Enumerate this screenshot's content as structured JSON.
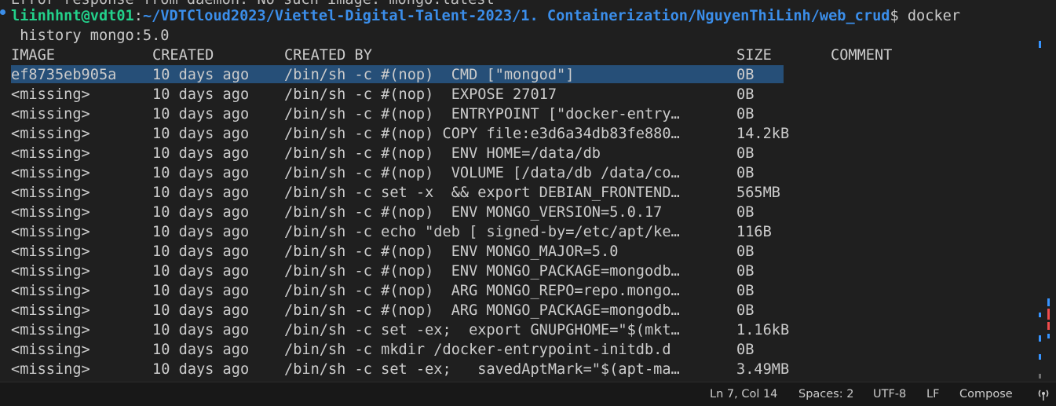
{
  "terminal": {
    "clipped_line": "Error response from daemon: No such image: mongo:latest",
    "prompt": {
      "user_host": "liinhhnt@vdt01",
      "colon": ":",
      "path": "~/VDTCloud2023/Viettel-Digital-Talent-2023/1. Containerization/NguyenThiLinh/web_crud",
      "dollar": "$ docker"
    },
    "command_continuation": " history mongo:5.0",
    "table": {
      "headers": {
        "image": "IMAGE",
        "created": "CREATED",
        "created_by": "CREATED BY",
        "size": "SIZE",
        "comment": "COMMENT"
      },
      "rows": [
        {
          "image": "ef8735eb905a",
          "created": "10 days ago",
          "created_by": "/bin/sh -c #(nop)  CMD [\"mongod\"]",
          "size": "0B"
        },
        {
          "image": "<missing>",
          "created": "10 days ago",
          "created_by": "/bin/sh -c #(nop)  EXPOSE 27017",
          "size": "0B"
        },
        {
          "image": "<missing>",
          "created": "10 days ago",
          "created_by": "/bin/sh -c #(nop)  ENTRYPOINT [\"docker-entry…",
          "size": "0B"
        },
        {
          "image": "<missing>",
          "created": "10 days ago",
          "created_by": "/bin/sh -c #(nop) COPY file:e3d6a34db83fe880…",
          "size": "14.2kB"
        },
        {
          "image": "<missing>",
          "created": "10 days ago",
          "created_by": "/bin/sh -c #(nop)  ENV HOME=/data/db",
          "size": "0B"
        },
        {
          "image": "<missing>",
          "created": "10 days ago",
          "created_by": "/bin/sh -c #(nop)  VOLUME [/data/db /data/co…",
          "size": "0B"
        },
        {
          "image": "<missing>",
          "created": "10 days ago",
          "created_by": "/bin/sh -c set -x  && export DEBIAN_FRONTEND…",
          "size": "565MB"
        },
        {
          "image": "<missing>",
          "created": "10 days ago",
          "created_by": "/bin/sh -c #(nop)  ENV MONGO_VERSION=5.0.17",
          "size": "0B"
        },
        {
          "image": "<missing>",
          "created": "10 days ago",
          "created_by": "/bin/sh -c echo \"deb [ signed-by=/etc/apt/ke…",
          "size": "116B"
        },
        {
          "image": "<missing>",
          "created": "10 days ago",
          "created_by": "/bin/sh -c #(nop)  ENV MONGO_MAJOR=5.0",
          "size": "0B"
        },
        {
          "image": "<missing>",
          "created": "10 days ago",
          "created_by": "/bin/sh -c #(nop)  ENV MONGO_PACKAGE=mongodb…",
          "size": "0B"
        },
        {
          "image": "<missing>",
          "created": "10 days ago",
          "created_by": "/bin/sh -c #(nop)  ARG MONGO_REPO=repo.mongo…",
          "size": "0B"
        },
        {
          "image": "<missing>",
          "created": "10 days ago",
          "created_by": "/bin/sh -c #(nop)  ARG MONGO_PACKAGE=mongodb…",
          "size": "0B"
        },
        {
          "image": "<missing>",
          "created": "10 days ago",
          "created_by": "/bin/sh -c set -ex;  export GNUPGHOME=\"$(mkt…",
          "size": "1.16kB"
        },
        {
          "image": "<missing>",
          "created": "10 days ago",
          "created_by": "/bin/sh -c mkdir /docker-entrypoint-initdb.d",
          "size": "0B"
        },
        {
          "image": "<missing>",
          "created": "10 days ago",
          "created_by": "/bin/sh -c set -ex;   savedAptMark=\"$(apt-ma…",
          "size": "3.49MB"
        }
      ]
    }
  },
  "statusbar": {
    "cursor_position": "Ln 7, Col 14",
    "indentation": "Spaces: 2",
    "encoding": "UTF-8",
    "line_ending": "LF",
    "language": "Compose",
    "notifications_icon": "broadcast-icon"
  },
  "colors": {
    "background": "#1f1f1f",
    "selection": "#264f78",
    "prompt_user": "#23d18b",
    "prompt_path": "#3b8eea",
    "scroll_mark_blue": "#3794ff",
    "scroll_mark_red": "#f14c4c"
  }
}
